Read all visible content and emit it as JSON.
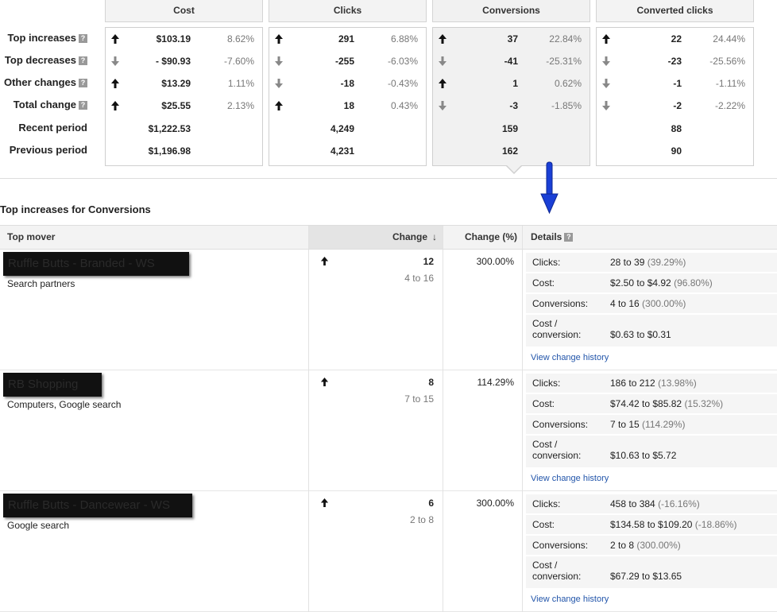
{
  "summary": {
    "row_labels": {
      "top_increases": "Top increases",
      "top_decreases": "Top decreases",
      "other_changes": "Other changes",
      "total_change": "Total change",
      "recent_period": "Recent period",
      "previous_period": "Previous period"
    },
    "columns": [
      {
        "title": "Cost",
        "top_increases": {
          "value": "$103.19",
          "pct": "8.62%",
          "dir": "up"
        },
        "top_decreases": {
          "value": "- $90.93",
          "pct": "-7.60%",
          "dir": "down"
        },
        "other_changes": {
          "value": "$13.29",
          "pct": "1.11%",
          "dir": "up"
        },
        "total_change": {
          "value": "$25.55",
          "pct": "2.13%",
          "dir": "up"
        },
        "recent_period": "$1,222.53",
        "previous_period": "$1,196.98"
      },
      {
        "title": "Clicks",
        "top_increases": {
          "value": "291",
          "pct": "6.88%",
          "dir": "up"
        },
        "top_decreases": {
          "value": "-255",
          "pct": "-6.03%",
          "dir": "down"
        },
        "other_changes": {
          "value": "-18",
          "pct": "-0.43%",
          "dir": "down"
        },
        "total_change": {
          "value": "18",
          "pct": "0.43%",
          "dir": "up"
        },
        "recent_period": "4,249",
        "previous_period": "4,231"
      },
      {
        "title": "Conversions",
        "top_increases": {
          "value": "37",
          "pct": "22.84%",
          "dir": "up"
        },
        "top_decreases": {
          "value": "-41",
          "pct": "-25.31%",
          "dir": "down"
        },
        "other_changes": {
          "value": "1",
          "pct": "0.62%",
          "dir": "up"
        },
        "total_change": {
          "value": "-3",
          "pct": "-1.85%",
          "dir": "down"
        },
        "recent_period": "159",
        "previous_period": "162"
      },
      {
        "title": "Converted clicks",
        "top_increases": {
          "value": "22",
          "pct": "24.44%",
          "dir": "up"
        },
        "top_decreases": {
          "value": "-23",
          "pct": "-25.56%",
          "dir": "down"
        },
        "other_changes": {
          "value": "-1",
          "pct": "-1.11%",
          "dir": "down"
        },
        "total_change": {
          "value": "-2",
          "pct": "-2.22%",
          "dir": "down"
        },
        "recent_period": "88",
        "previous_period": "90"
      }
    ],
    "help_glyph": "?"
  },
  "section_title": "Top increases for Conversions",
  "table": {
    "headers": {
      "top_mover": "Top mover",
      "change": "Change",
      "change_pct": "Change (%)",
      "details": "Details"
    },
    "detail_labels": {
      "clicks": "Clicks:",
      "cost": "Cost:",
      "conversions": "Conversions:",
      "cost_per_conv_1": "Cost /",
      "cost_per_conv_2": "conversion:"
    },
    "view_history": "View change history",
    "rows": [
      {
        "name": "Ruffle Butts - Branded - WS",
        "sub": "Search partners",
        "change": "12",
        "range": "4 to 16",
        "pct": "300.00%",
        "clicks": "28 to 39",
        "clicks_pct": "(39.29%)",
        "cost": "$2.50 to $4.92",
        "cost_pct": "(96.80%)",
        "conv": "4 to 16",
        "conv_pct": "(300.00%)",
        "cpc": "$0.63 to $0.31"
      },
      {
        "name": "RB Shopping",
        "sub": "Computers, Google search",
        "change": "8",
        "range": "7 to 15",
        "pct": "114.29%",
        "clicks": "186 to 212",
        "clicks_pct": "(13.98%)",
        "cost": "$74.42 to $85.82",
        "cost_pct": "(15.32%)",
        "conv": "7 to 15",
        "conv_pct": "(114.29%)",
        "cpc": "$10.63 to $5.72"
      },
      {
        "name": "Ruffle Butts - Dancewear - WS",
        "sub": "Google search",
        "change": "6",
        "range": "2 to 8",
        "pct": "300.00%",
        "clicks": "458 to 384",
        "clicks_pct": "(-16.16%)",
        "cost": "$134.58 to $109.20",
        "cost_pct": "(-18.86%)",
        "conv": "2 to 8",
        "conv_pct": "(300.00%)",
        "cpc": "$67.29 to $13.65"
      }
    ]
  },
  "colors": {
    "annotation_arrow": "#1a3fd6",
    "link": "#2255aa"
  }
}
